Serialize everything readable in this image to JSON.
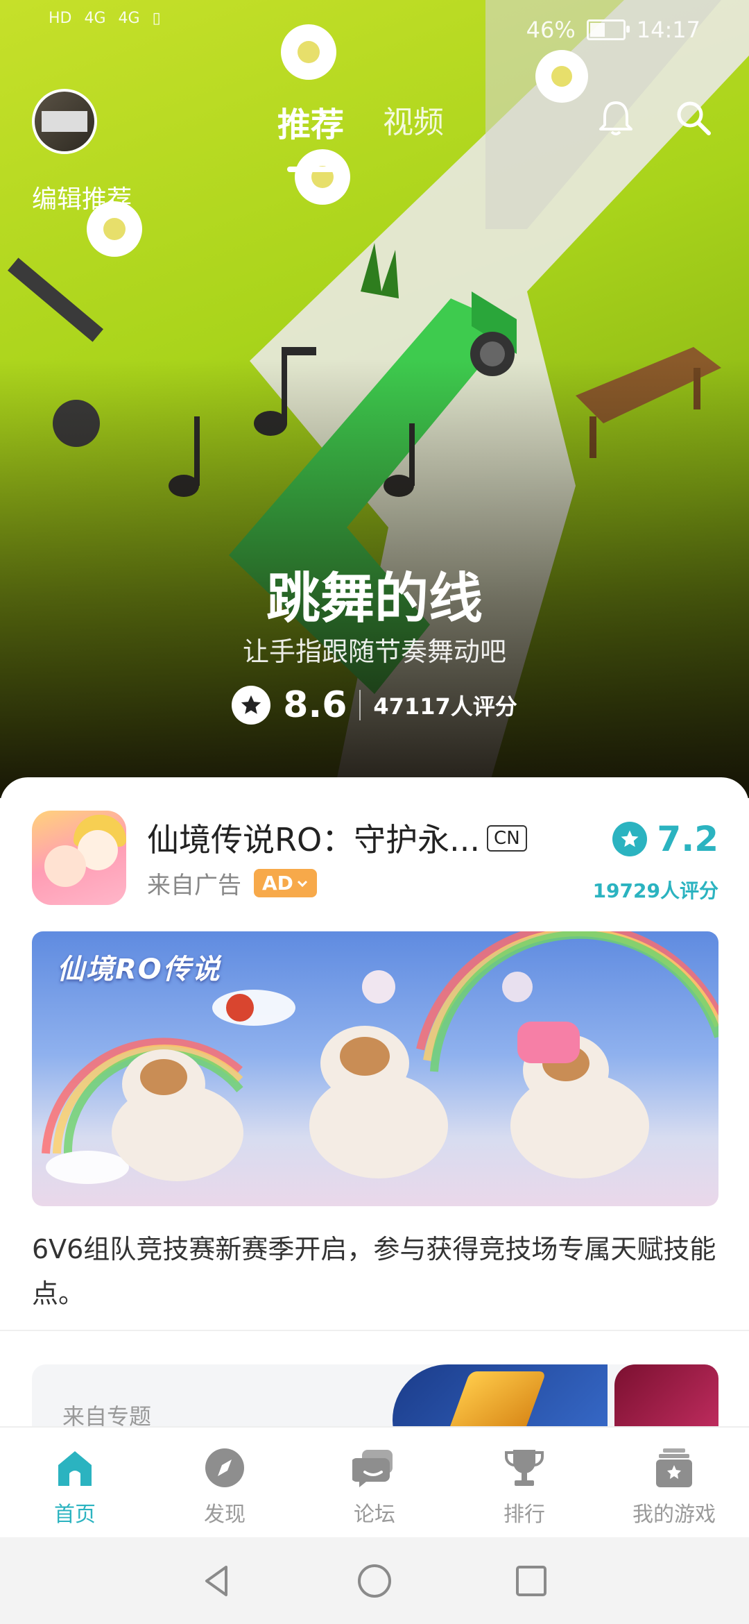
{
  "status_bar": {
    "left_labels": [
      "HD",
      "4G",
      "4G"
    ],
    "battery": "46%",
    "battery_level": 0.46,
    "time": "14:17"
  },
  "header": {
    "edit_label": "编辑推荐",
    "tabs": [
      {
        "label": "推荐",
        "active": true
      },
      {
        "label": "视频",
        "active": false
      }
    ],
    "icons": [
      "bell-icon",
      "search-icon"
    ]
  },
  "hero": {
    "title": "跳舞的线",
    "subtitle": "让手指跟随节奏舞动吧",
    "score": "8.6",
    "rating_count": "47117人评分"
  },
  "ad_card": {
    "title": "仙境传说RO：守护永...",
    "region_badge": "CN",
    "source": "来自广告",
    "ad_badge": "AD",
    "score": "7.2",
    "rating_count": "19729人评分",
    "banner_logo": "仙境RO传说",
    "description": "6V6组队竞技赛新赛季开启，参与获得竞技场专属天赋技能点。"
  },
  "topic_card": {
    "label": "来自专题"
  },
  "bottom_nav": {
    "items": [
      {
        "label": "首页",
        "icon": "home-icon",
        "active": true
      },
      {
        "label": "发现",
        "icon": "compass-icon",
        "active": false
      },
      {
        "label": "论坛",
        "icon": "forum-icon",
        "active": false
      },
      {
        "label": "排行",
        "icon": "trophy-icon",
        "active": false
      },
      {
        "label": "我的游戏",
        "icon": "my-games-icon",
        "active": false
      }
    ]
  },
  "colors": {
    "accent": "#2bb3c0",
    "ad_badge": "#f7a94a",
    "hero_green": "#a9d41b"
  }
}
